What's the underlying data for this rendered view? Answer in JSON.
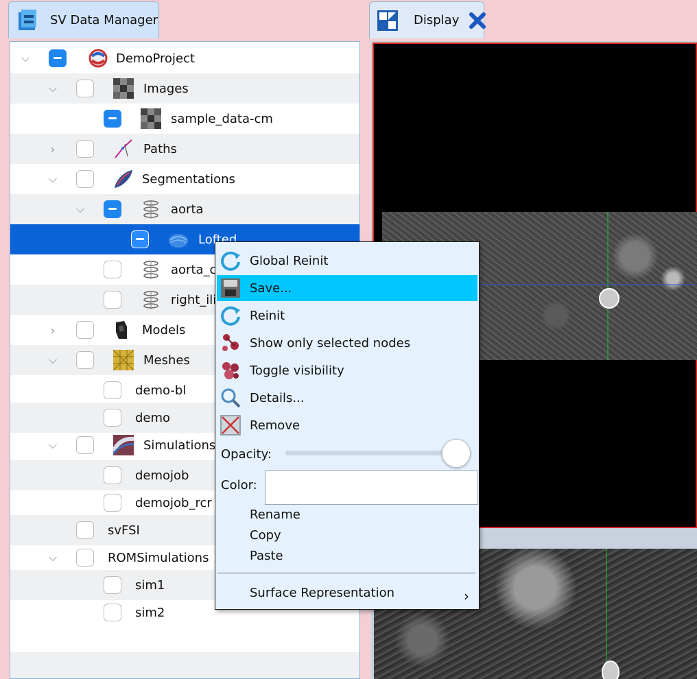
{
  "tabs": {
    "data_manager": "SV Data Manager",
    "display": "Display"
  },
  "tree": [
    {
      "label": "DemoProject"
    },
    {
      "label": "Images"
    },
    {
      "label": "sample_data-cm"
    },
    {
      "label": "Paths"
    },
    {
      "label": "Segmentations"
    },
    {
      "label": "aorta"
    },
    {
      "label": "Lofted"
    },
    {
      "label": "aorta_cc"
    },
    {
      "label": "right_iliac"
    },
    {
      "label": "Models"
    },
    {
      "label": "Meshes"
    },
    {
      "label": "demo-bl"
    },
    {
      "label": "demo"
    },
    {
      "label": "Simulations"
    },
    {
      "label": "demojob"
    },
    {
      "label": "demojob_rcr"
    },
    {
      "label": "svFSI"
    },
    {
      "label": "ROMSimulations"
    },
    {
      "label": "sim1"
    },
    {
      "label": "sim2"
    }
  ],
  "menu": {
    "items": [
      {
        "label": "Global Reinit"
      },
      {
        "label": "Save..."
      },
      {
        "label": "Reinit"
      },
      {
        "label": "Show only selected nodes"
      },
      {
        "label": "Toggle visibility"
      },
      {
        "label": "Details..."
      },
      {
        "label": "Remove"
      }
    ],
    "opacity_label": "Opacity:",
    "opacity_value": 1.0,
    "color_label": "Color:",
    "color_value": "",
    "rename": "Rename",
    "copy": "Copy",
    "paste": "Paste",
    "surface_representation": "Surface Representation",
    "submenu_arrow": "›"
  },
  "colors": {
    "selection": "#0b63d8",
    "menu_highlight": "#00c8ff",
    "checkbox_partial": "#1f86ee",
    "view_border": "#d2241e"
  }
}
